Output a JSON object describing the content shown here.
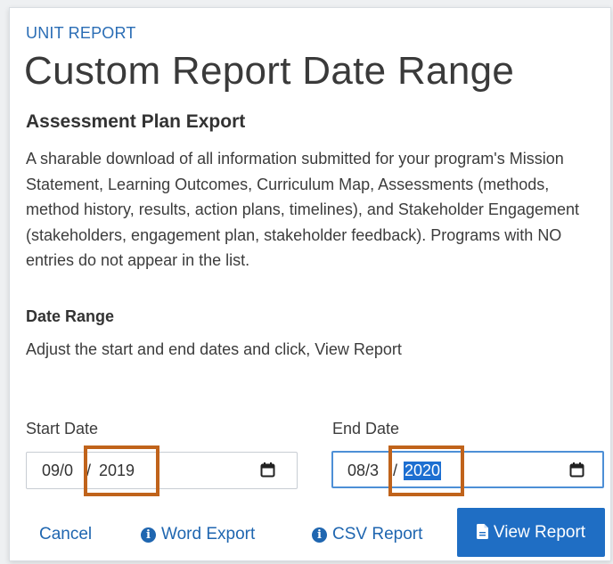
{
  "header": {
    "eyebrow": "UNIT REPORT",
    "title": "Custom Report Date Range"
  },
  "export": {
    "title": "Assessment Plan Export",
    "description": "A sharable download of all information submitted for your program's Mission Statement, Learning Outcomes, Curriculum Map, Assessments (methods, method history, results, action plans, timelines), and Stakeholder Engagement (stakeholders, engagement plan, stakeholder feedback). Programs with NO entries do not appear in the list."
  },
  "date_range": {
    "label": "Date Range",
    "instruction": "Adjust the start and end dates and click, View Report"
  },
  "start_date": {
    "label": "Start Date",
    "visible_month_day": "09/0",
    "visible_year_prefix": " /",
    "visible_year": "2019",
    "icon": "calendar-icon"
  },
  "end_date": {
    "label": "End Date",
    "visible_month_day": "08/3",
    "visible_year_prefix": " /",
    "visible_year": "2020",
    "icon": "calendar-icon"
  },
  "actions": {
    "cancel_label": "Cancel",
    "word_export_label": "Word Export",
    "csv_report_label": "CSV Report",
    "view_report_label": "View Report"
  },
  "colors": {
    "accent": "#1f6ec4",
    "link": "#1f66b0",
    "callout": "#c0631b",
    "selection": "#1d6fd1"
  }
}
